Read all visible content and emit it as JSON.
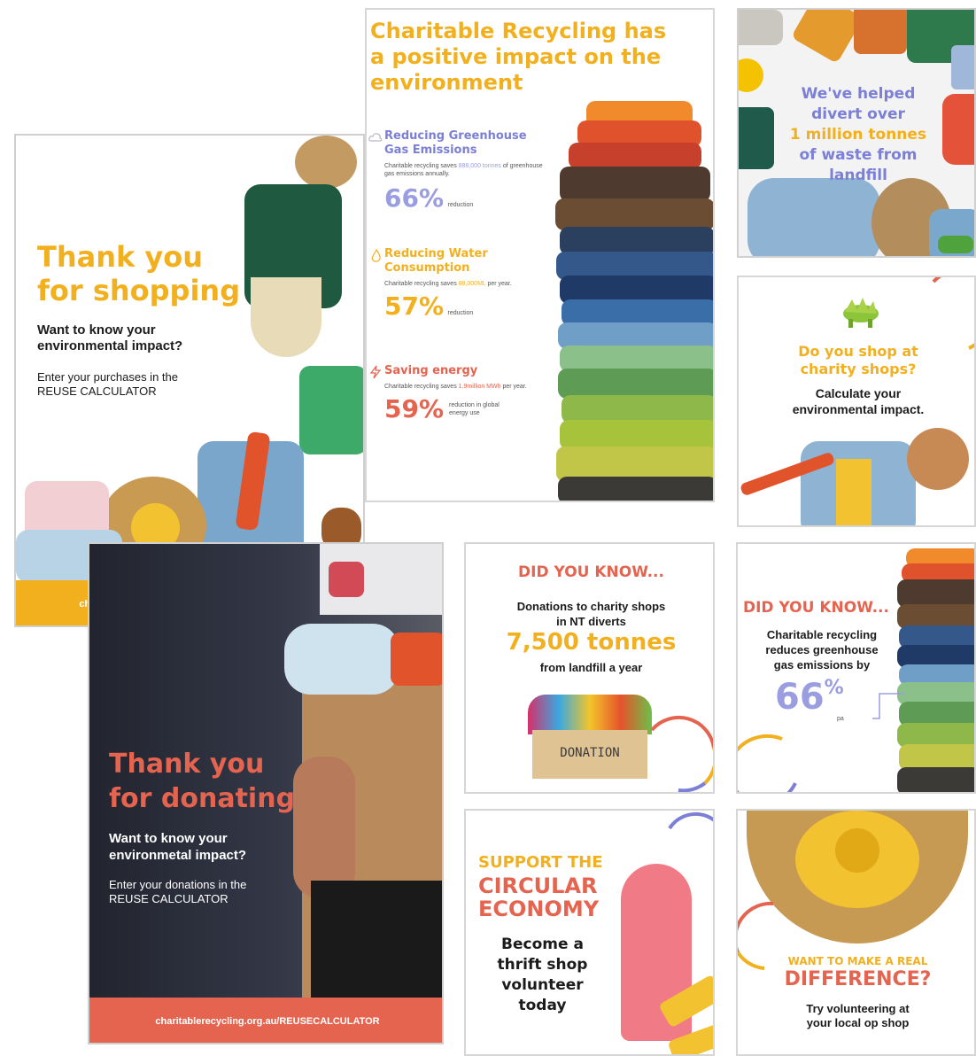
{
  "colors": {
    "yellow": "#f2b01e",
    "coral": "#e5644f",
    "purple": "#7b7fd6",
    "dark": "#22242f"
  },
  "shopping": {
    "title_line1": "Thank you",
    "title_line2": "for shopping",
    "subtitle": "Want to know your environmental impact?",
    "body": "Enter your purchases in the REUSE CALCULATOR",
    "url": "charitablerecycling.org.au/REUSECALCULATOR"
  },
  "donating": {
    "title_line1": "Thank you",
    "title_line2": "for donating",
    "subtitle": "Want to know your environmetal impact?",
    "body": "Enter your donations in the REUSE CALCULATOR",
    "url": "charitablerecycling.org.au/REUSECALCULATOR"
  },
  "impact": {
    "title": "Charitable Recycling has a positive impact on the environment",
    "sections": [
      {
        "icon": "cloud-icon",
        "heading": "Reducing Greenhouse Gas Emissions",
        "text_pre": "Charitable recycling saves ",
        "highlight": "888,000 tonnes",
        "text_post": " of greenhouse gas emissions annually.",
        "percent": "66%",
        "caption": "reduction"
      },
      {
        "icon": "water-drop-icon",
        "heading": "Reducing Water Consumption",
        "text_pre": "Charitable recycling saves ",
        "highlight": "88,000ML",
        "text_post": " per year.",
        "percent": "57%",
        "caption": "reduction"
      },
      {
        "icon": "energy-icon",
        "heading": "Saving energy",
        "text_pre": "Charitable recycling saves ",
        "highlight": "1.9million MWh",
        "text_post": " per year.",
        "percent": "59%",
        "caption": "reduction in global energy use"
      }
    ]
  },
  "divert": {
    "text": "We've helped divert over 1 million tonnes of waste from landfill",
    "line1": "We've helped",
    "line2": "divert over",
    "line3": "1 million tonnes",
    "line4": "of waste from",
    "line5": "landfill"
  },
  "charity_shop": {
    "question_line1": "Do you shop at",
    "question_line2": "charity shops?",
    "sub_line1": "Calculate your",
    "sub_line2": "environmental impact."
  },
  "dyk_nt": {
    "heading": "DID YOU KNOW...",
    "line1": "Donations to charity shops",
    "line2": "in NT diverts",
    "big": "7,500 tonnes",
    "line3": "from landfill a year",
    "box_label": "DONATION"
  },
  "dyk_ghg": {
    "heading": "DID YOU KNOW...",
    "line1": "Charitable recycling",
    "line2": "reduces greenhouse",
    "line3": "gas emissions by",
    "big": "66",
    "unit": "%",
    "pa": "pa"
  },
  "circular": {
    "line1": "SUPPORT THE",
    "line2": "CIRCULAR",
    "line3": "ECONOMY",
    "cta1": "Become a",
    "cta2": "thrift shop",
    "cta3": "volunteer",
    "cta4": "today"
  },
  "difference": {
    "line1": "WANT TO MAKE A REAL",
    "line2": "DIFFERENCE?",
    "cta1": "Try volunteering at",
    "cta2": "your local op shop"
  }
}
